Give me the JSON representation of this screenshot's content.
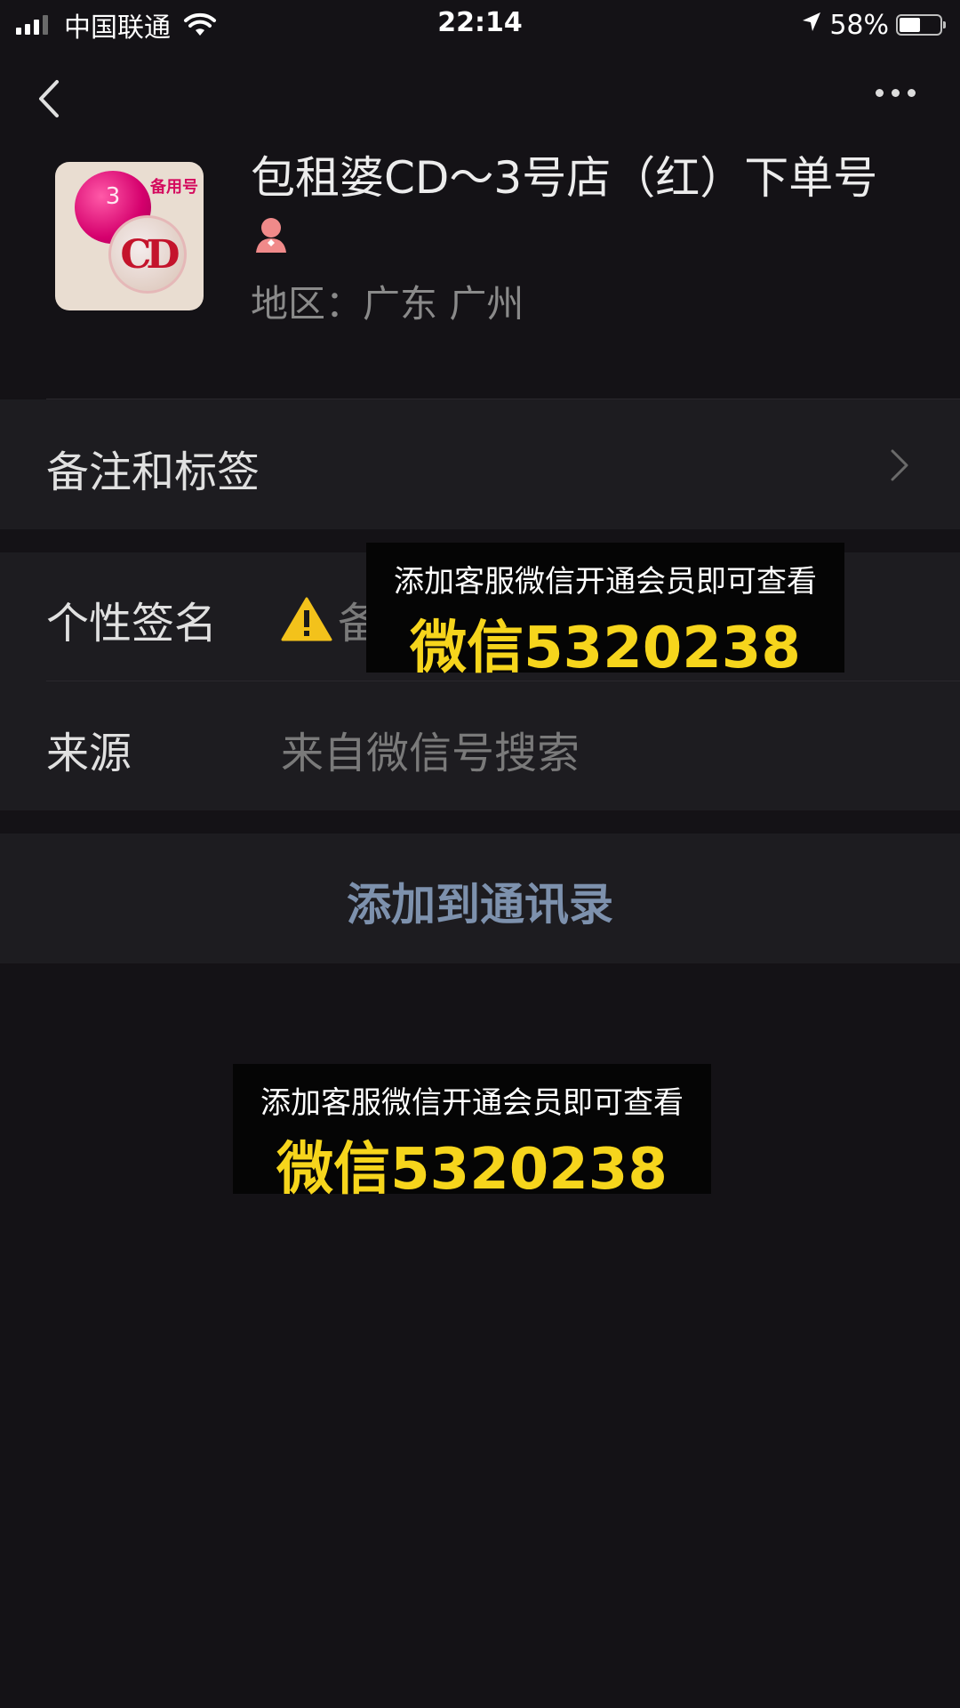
{
  "status_bar": {
    "carrier": "中国联通",
    "time": "22:14",
    "battery": "58%",
    "battery_level": 0.58
  },
  "profile": {
    "name": "包租婆CD～3号店（红）下单号",
    "region": "地区：广东 广州",
    "avatar": {
      "balloon_number": "3",
      "tag": "备用号",
      "logo": "CD"
    }
  },
  "cells": {
    "remark_label": "备注和标签",
    "signature_label": "个性签名",
    "signature_value": "备",
    "source_label": "来源",
    "source_value": "来自微信号搜索"
  },
  "actions": {
    "add_contact": "添加到通讯录"
  },
  "promos": [
    {
      "line1": "添加客服微信开通会员即可查看",
      "line2": "微信5320238"
    },
    {
      "line1": "添加客服微信开通会员即可查看",
      "line2": "微信5320238"
    }
  ],
  "colors": {
    "background": "#141216",
    "cell_background": "#1d1c20",
    "action_text": "#7d91ad",
    "promo_highlight": "#f6d51c"
  }
}
